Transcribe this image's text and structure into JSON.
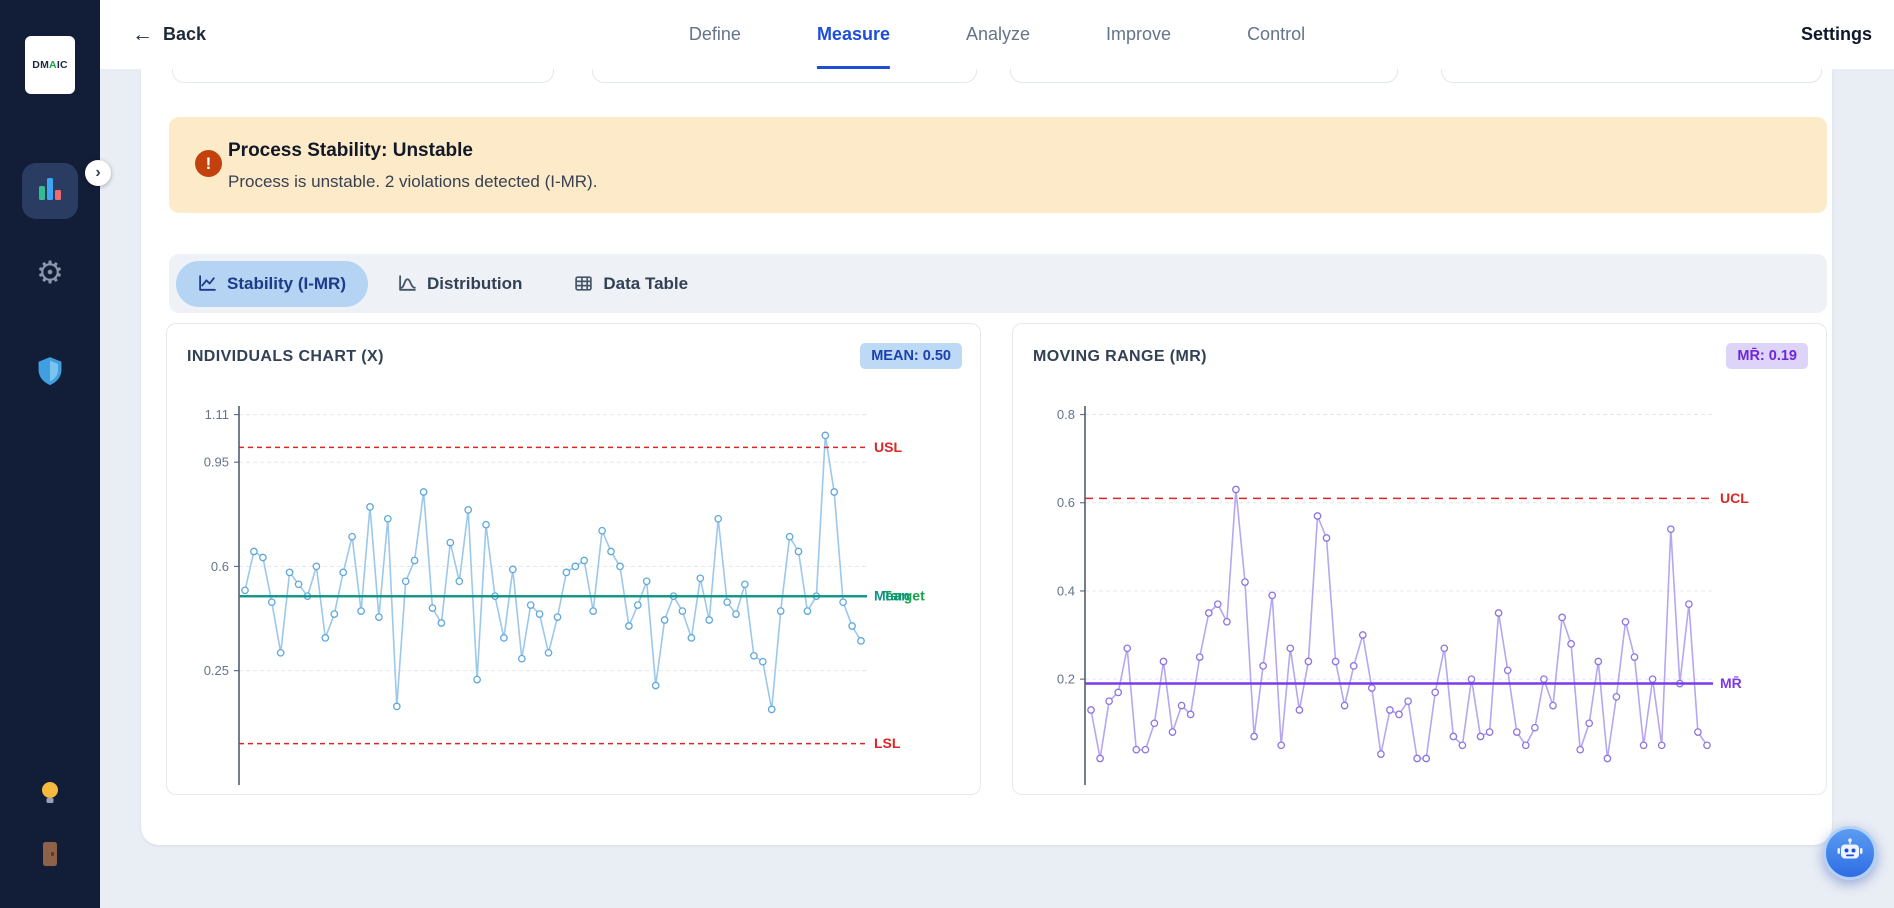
{
  "theme": {
    "accent": "#1d4ed8",
    "sidebar_bg": "#121d38",
    "alert_bg": "#fdeac9",
    "alert_icon_color": "#c2410c",
    "mean_badge_bg": "#bdd9f5",
    "mr_badge_bg": "#ded3f8",
    "limit_color": "#dc2626",
    "mean_line_color": "#0d9488",
    "mr_line_color": "#7c3aed"
  },
  "sidebar": {
    "logo_letters": [
      {
        "ch": "D",
        "color": "#1e293b"
      },
      {
        "ch": "M",
        "color": "#1e293b"
      },
      {
        "ch": "A",
        "color": "#16a34a"
      },
      {
        "ch": "I",
        "color": "#1e293b"
      },
      {
        "ch": "C",
        "color": "#1e293b"
      }
    ],
    "expand_glyph": "›",
    "gear_glyph": "⚙"
  },
  "navbar": {
    "back_arrow": "←",
    "back_label": "Back",
    "tabs": [
      {
        "label": "Define",
        "active": false
      },
      {
        "label": "Measure",
        "active": true
      },
      {
        "label": "Analyze",
        "active": false
      },
      {
        "label": "Improve",
        "active": false
      },
      {
        "label": "Control",
        "active": false
      }
    ],
    "settings_label": "Settings"
  },
  "alert": {
    "icon_glyph": "!",
    "title": "Process Stability: Unstable",
    "message": "Process is unstable. 2 violations detected (I-MR)."
  },
  "view_tabs": [
    {
      "label": "Stability (I-MR)",
      "active": true
    },
    {
      "label": "Distribution",
      "active": false
    },
    {
      "label": "Data Table",
      "active": false
    }
  ],
  "cards": {
    "individuals": {
      "title": "INDIVIDUALS CHART (X)",
      "badge": "MEAN: 0.50"
    },
    "moving_range": {
      "title": "MOVING RANGE (MR)",
      "badge": "MR̄: 0.19"
    }
  },
  "chart_data": [
    {
      "type": "line",
      "title": "INDIVIDUALS CHART (X)",
      "xlabel": "",
      "ylabel": "",
      "ylim": [
        -0.134,
        1.122
      ],
      "yticks": [
        1.11,
        0.95,
        0.6,
        0.25
      ],
      "grid": true,
      "legend": "none",
      "line_color": "#9cc8ec",
      "marker_color": "#5fa8dc",
      "reference_lines": [
        {
          "label": "USL",
          "value": 1.0,
          "color": "#dc2626",
          "style": "dashed",
          "dash": "5 4",
          "width": 1.5
        },
        {
          "label": "Target",
          "value": 0.5,
          "color": "#16a34a",
          "style": "solid",
          "width": 2,
          "label_dx": 9
        },
        {
          "label": "Mean",
          "value": 0.5,
          "color": "#0d9488",
          "style": "solid",
          "width": 2.2
        },
        {
          "label": "LSL",
          "value": 0.005,
          "color": "#dc2626",
          "style": "dashed",
          "dash": "5 4",
          "width": 1.5
        }
      ],
      "series": [
        {
          "name": "Individuals",
          "values": [
            0.52,
            0.65,
            0.63,
            0.48,
            0.31,
            0.58,
            0.54,
            0.5,
            0.6,
            0.36,
            0.44,
            0.58,
            0.7,
            0.45,
            0.8,
            0.43,
            0.76,
            0.13,
            0.55,
            0.62,
            0.85,
            0.46,
            0.41,
            0.68,
            0.55,
            0.79,
            0.22,
            0.74,
            0.5,
            0.36,
            0.59,
            0.29,
            0.47,
            0.44,
            0.31,
            0.43,
            0.58,
            0.6,
            0.62,
            0.45,
            0.72,
            0.65,
            0.6,
            0.4,
            0.47,
            0.55,
            0.2,
            0.42,
            0.5,
            0.45,
            0.36,
            0.56,
            0.42,
            0.76,
            0.48,
            0.44,
            0.54,
            0.3,
            0.28,
            0.12,
            0.45,
            0.7,
            0.65,
            0.45,
            0.5,
            1.04,
            0.85,
            0.48,
            0.4,
            0.35
          ]
        }
      ]
    },
    {
      "type": "line",
      "title": "MOVING RANGE (MR)",
      "xlabel": "",
      "ylabel": "",
      "ylim": [
        -0.04,
        0.808
      ],
      "yticks": [
        0.8,
        0.6,
        0.4,
        0.2
      ],
      "grid": true,
      "legend": "none",
      "line_color": "#b7a6f0",
      "marker_color": "#8d74e3",
      "reference_lines": [
        {
          "label": "UCL",
          "value": 0.61,
          "color": "#dc2626",
          "style": "dashed",
          "dash": "8 6",
          "width": 1.5
        },
        {
          "label": "MR̄",
          "value": 0.19,
          "color": "#7c3aed",
          "style": "solid",
          "width": 2.5
        }
      ],
      "series": [
        {
          "name": "Moving Range",
          "values": [
            0.13,
            0.02,
            0.15,
            0.17,
            0.27,
            0.04,
            0.04,
            0.1,
            0.24,
            0.08,
            0.14,
            0.12,
            0.25,
            0.35,
            0.37,
            0.33,
            0.63,
            0.42,
            0.07,
            0.23,
            0.39,
            0.05,
            0.27,
            0.13,
            0.24,
            0.57,
            0.52,
            0.24,
            0.14,
            0.23,
            0.3,
            0.18,
            0.03,
            0.13,
            0.12,
            0.15,
            0.02,
            0.02,
            0.17,
            0.27,
            0.07,
            0.05,
            0.2,
            0.07,
            0.08,
            0.35,
            0.22,
            0.08,
            0.05,
            0.09,
            0.2,
            0.14,
            0.34,
            0.28,
            0.04,
            0.1,
            0.24,
            0.02,
            0.16,
            0.33,
            0.25,
            0.05,
            0.2,
            0.05,
            0.54,
            0.19,
            0.37,
            0.08,
            0.05
          ]
        }
      ]
    }
  ]
}
